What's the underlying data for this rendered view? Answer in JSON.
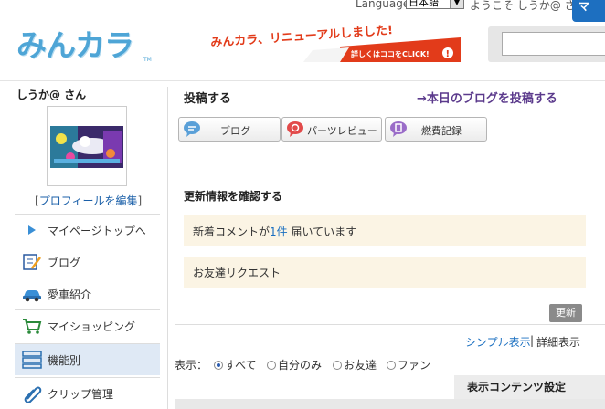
{
  "header": {
    "language_label": "Language",
    "language_value": "日本語",
    "welcome": "ようこそ しうか@ さん",
    "my_button": "マ",
    "logo_text": "みんカラ",
    "logo_tm": "TM",
    "banner_main": "みんカラ、リニューアルしました!",
    "banner_sub": "詳しくはココをCLICK!",
    "search_placeholder": ""
  },
  "sidebar": {
    "user_name": "しうか@ さん",
    "profile_edit_prefix": "[",
    "profile_edit_link": "プロフィールを編集",
    "profile_edit_suffix": "]",
    "items": [
      {
        "label": "マイページトップへ",
        "icon": "play-arrow-icon"
      },
      {
        "label": "ブログ",
        "icon": "blog-pen-icon"
      },
      {
        "label": "愛車紹介",
        "icon": "car-icon"
      },
      {
        "label": "マイショッピング",
        "icon": "shopping-cart-icon"
      },
      {
        "label": "機能別",
        "icon": "list-icon"
      },
      {
        "label": "クリップ管理",
        "icon": "clip-icon"
      }
    ]
  },
  "main": {
    "post_title": "投稿する",
    "post_today": "→本日のブログを投稿する",
    "post_buttons": [
      {
        "label": "ブログ",
        "icon": "speech-bubble-icon",
        "color": "#5aa0d8"
      },
      {
        "label": "パーツレビュー",
        "icon": "review-icon",
        "color": "#e24a4a"
      },
      {
        "label": "燃費記録",
        "icon": "fuel-icon",
        "color": "#9a6cc8"
      }
    ],
    "update_title": "更新情報を確認する",
    "notice_comment_prefix": "新着コメントが",
    "notice_comment_link": "1件",
    "notice_comment_suffix": "届いています",
    "notice_friend": "お友達リクエスト",
    "refresh_button": "更新",
    "view_simple": "シンプル表示",
    "view_sep": "|",
    "view_detail": "詳細表示",
    "filter_label": "表示：",
    "filters": [
      {
        "label": "すべて",
        "selected": true
      },
      {
        "label": "自分のみ",
        "selected": false
      },
      {
        "label": "お友達",
        "selected": false
      },
      {
        "label": "ファン",
        "selected": false
      }
    ],
    "content_setting": "表示コンテンツ設定"
  },
  "colors": {
    "accent": "#1d6fc0",
    "logo": "#4ea5d6",
    "notice_bg": "#fbf4e4",
    "link": "#1a6fc0"
  }
}
